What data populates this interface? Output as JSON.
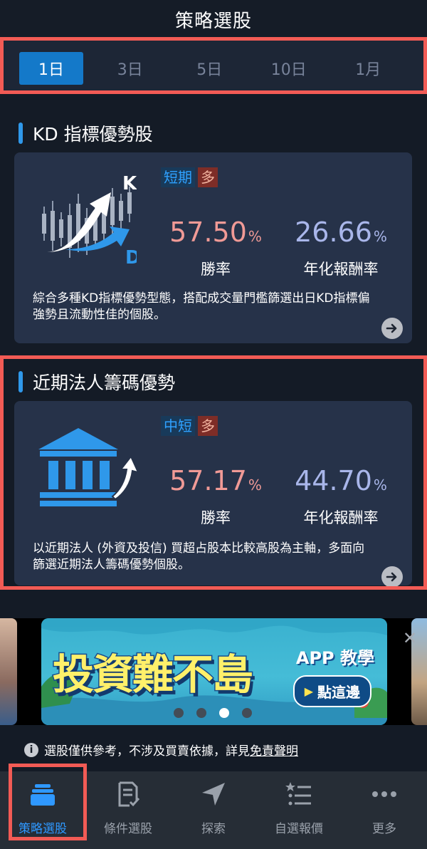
{
  "header": {
    "title": "策略選股"
  },
  "tabs": [
    {
      "label": "1日",
      "active": true
    },
    {
      "label": "3日"
    },
    {
      "label": "5日"
    },
    {
      "label": "10日"
    },
    {
      "label": "1月"
    }
  ],
  "strategies": [
    {
      "title": "KD 指標優勢股",
      "icon": "kd-chart-icon",
      "term_tag": "短期",
      "direction_tag": "多",
      "win_rate": "57.50",
      "win_rate_label": "勝率",
      "annual_return": "26.66",
      "annual_return_label": "年化報酬率",
      "percent_sign": "%",
      "description": "綜合多種KD指標優勢型態，搭配成交量門檻篩選出日KD指標偏強勢且流動性佳的個股。"
    },
    {
      "title": "近期法人籌碼優勢",
      "icon": "institution-icon",
      "term_tag": "中短",
      "direction_tag": "多",
      "win_rate": "57.17",
      "win_rate_label": "勝率",
      "annual_return": "44.70",
      "annual_return_label": "年化報酬率",
      "percent_sign": "%",
      "description": "以近期法人 (外資及投信) 買超占股本比較高股為主軸，多面向篩選近期法人籌碼優勢個股。"
    }
  ],
  "banner": {
    "headline": "投資難不島",
    "app_label": "APP 教學",
    "cta": "點這邊",
    "close": "✕",
    "page_count": 4,
    "active_page": 3
  },
  "disclaimer": {
    "text": "選股僅供參考，不涉及買賣依據，詳見",
    "link": "免責聲明"
  },
  "bottom_nav": [
    {
      "label": "策略選股",
      "icon": "stack-icon",
      "active": true
    },
    {
      "label": "條件選股",
      "icon": "document-check-icon"
    },
    {
      "label": "探索",
      "icon": "navigation-arrow-icon"
    },
    {
      "label": "自選報價",
      "icon": "star-list-icon"
    },
    {
      "label": "更多",
      "icon": "more-dots-icon"
    }
  ],
  "colors": {
    "accent": "#1479c9",
    "highlight_frame": "#f25b55",
    "win_rate": "#f09a96",
    "annual_return": "#a9b6ea"
  }
}
